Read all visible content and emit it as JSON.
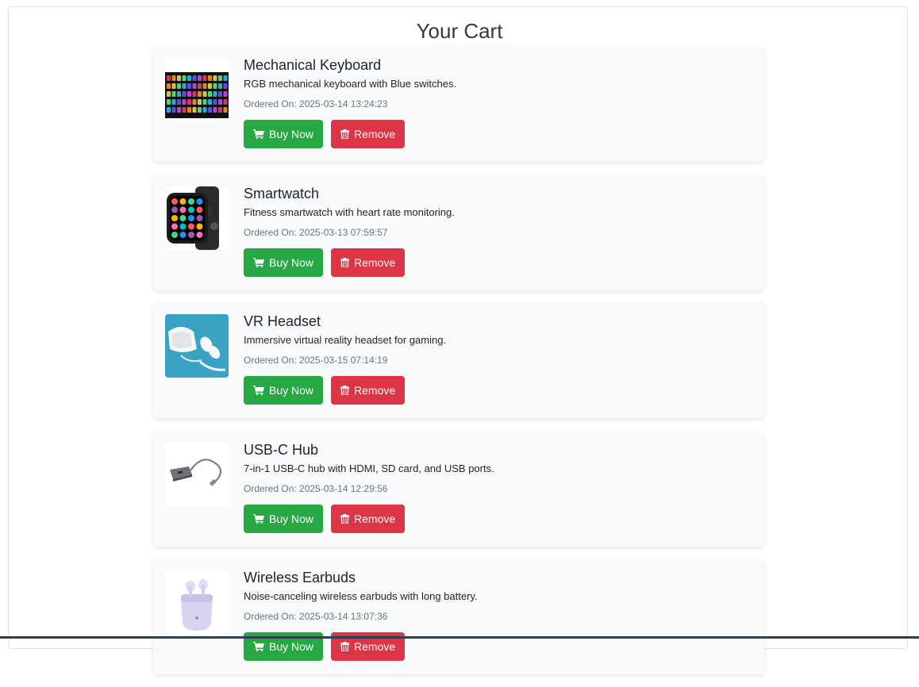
{
  "page": {
    "title": "Your Cart"
  },
  "colors": {
    "buy": "#28a745",
    "remove": "#dc3545",
    "card_bg": "#f8f9fa",
    "date_text": "#6c757d"
  },
  "cart": {
    "items": [
      {
        "name": "Mechanical Keyboard",
        "description": "RGB mechanical keyboard with Blue switches.",
        "ordered_on": "Ordered On: 2025-03-14 13:24:23",
        "buy_label": "Buy Now",
        "remove_label": "Remove",
        "image": "keyboard-image"
      },
      {
        "name": "Smartwatch",
        "description": "Fitness smartwatch with heart rate monitoring.",
        "ordered_on": "Ordered On: 2025-03-13 07:59:57",
        "buy_label": "Buy Now",
        "remove_label": "Remove",
        "image": "smartwatch-image"
      },
      {
        "name": "VR Headset",
        "description": "Immersive virtual reality headset for gaming.",
        "ordered_on": "Ordered On: 2025-03-15 07:14:19",
        "buy_label": "Buy Now",
        "remove_label": "Remove",
        "image": "vr-headset-image"
      },
      {
        "name": "USB-C Hub",
        "description": "7-in-1 USB-C hub with HDMI, SD card, and USB ports.",
        "ordered_on": "Ordered On: 2025-03-14 12:29:56",
        "buy_label": "Buy Now",
        "remove_label": "Remove",
        "image": "usb-hub-image"
      },
      {
        "name": "Wireless Earbuds",
        "description": "Noise-canceling wireless earbuds with long battery.",
        "ordered_on": "Ordered On: 2025-03-14 13:07:36",
        "buy_label": "Buy Now",
        "remove_label": "Remove",
        "image": "earbuds-image"
      }
    ]
  },
  "icons": {
    "buy": "cart-icon",
    "remove": "trash-icon"
  }
}
